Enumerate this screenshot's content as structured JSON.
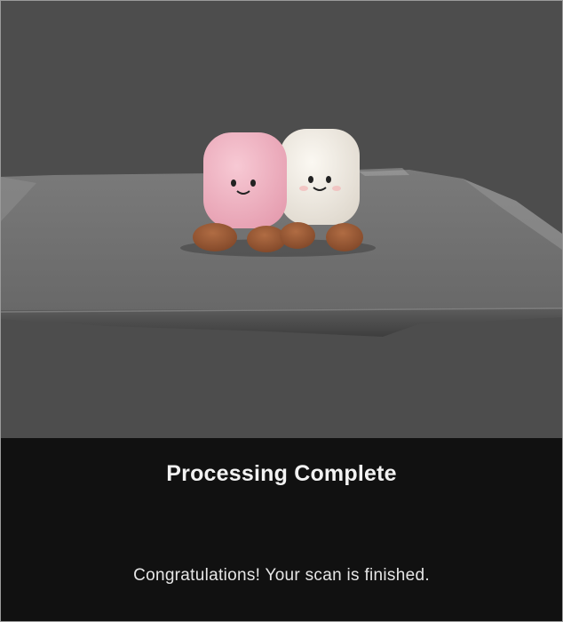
{
  "dialog": {
    "title": "Processing Complete",
    "message": "Congratulations! Your scan is finished."
  },
  "scan_preview": {
    "subject": "two plush marshmallow toys on a grey mat",
    "colors": {
      "background": "#4d4d4d",
      "mat": "#6c6c6c",
      "pink_plush": "#f0b3c2",
      "white_plush": "#f3efe8",
      "feet": "#9a5a35",
      "panel": "#111111"
    }
  }
}
